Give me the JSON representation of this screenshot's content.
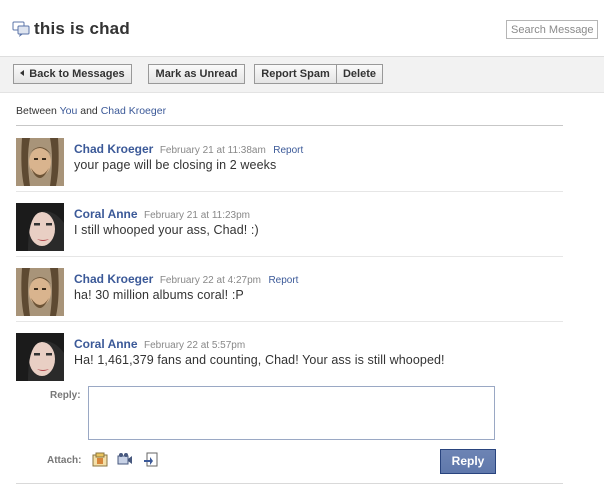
{
  "header": {
    "title": "this is chad",
    "search_placeholder": "Search Messages"
  },
  "toolbar": {
    "back_label": "Back to Messages",
    "unread_label": "Mark as Unread",
    "spam_label": "Report Spam",
    "delete_label": "Delete"
  },
  "between": {
    "prefix": "Between",
    "you": "You",
    "and": "and",
    "other": "Chad Kroeger"
  },
  "messages": [
    {
      "name": "Chad Kroeger",
      "date": "February 21 at 11:38am",
      "report": "Report",
      "body": "your page will be closing in 2 weeks"
    },
    {
      "name": "Coral Anne",
      "date": "February 21 at 11:23pm",
      "report": "",
      "body": "I still whooped your ass, Chad! :)"
    },
    {
      "name": "Chad Kroeger",
      "date": "February 22 at 4:27pm",
      "report": "Report",
      "body": "ha! 30 million albums coral! :P"
    },
    {
      "name": "Coral Anne",
      "date": "February 22 at 5:57pm",
      "report": "",
      "body": "Ha! 1,461,379 fans and counting, Chad! Your ass is still whooped!"
    }
  ],
  "reply": {
    "label": "Reply:",
    "value": "",
    "attach_label": "Attach:",
    "attach_icons": [
      "photo-icon",
      "video-icon",
      "link-icon"
    ],
    "button_label": "Reply"
  },
  "colors": {
    "link": "#3b5998",
    "reply_button": "#5f78ab"
  }
}
